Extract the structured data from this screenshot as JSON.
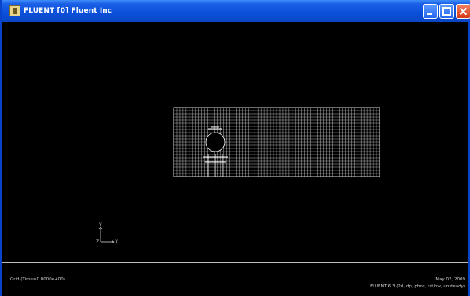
{
  "window": {
    "title": "FLUENT [0] Fluent Inc"
  },
  "graphics": {
    "axis_y_label": "Y",
    "axis_z_label": "Z",
    "axis_x_label": "X"
  },
  "status": {
    "grid_label": "Grid  (Time=0.0000e+00)",
    "date": "May 02, 2009",
    "version": "FLUENT 6.3 (2d, dp, pbns, rstlow, unsteady)"
  },
  "colors": {
    "titlebar": "#0b4fd9",
    "background": "#000000",
    "mesh_lines": "#d8d8d8",
    "cylinder": "#000000"
  },
  "icons": {
    "app": "fluent-app-icon",
    "minimize": "minimize-icon",
    "maximize": "maximize-icon",
    "close": "close-icon"
  }
}
